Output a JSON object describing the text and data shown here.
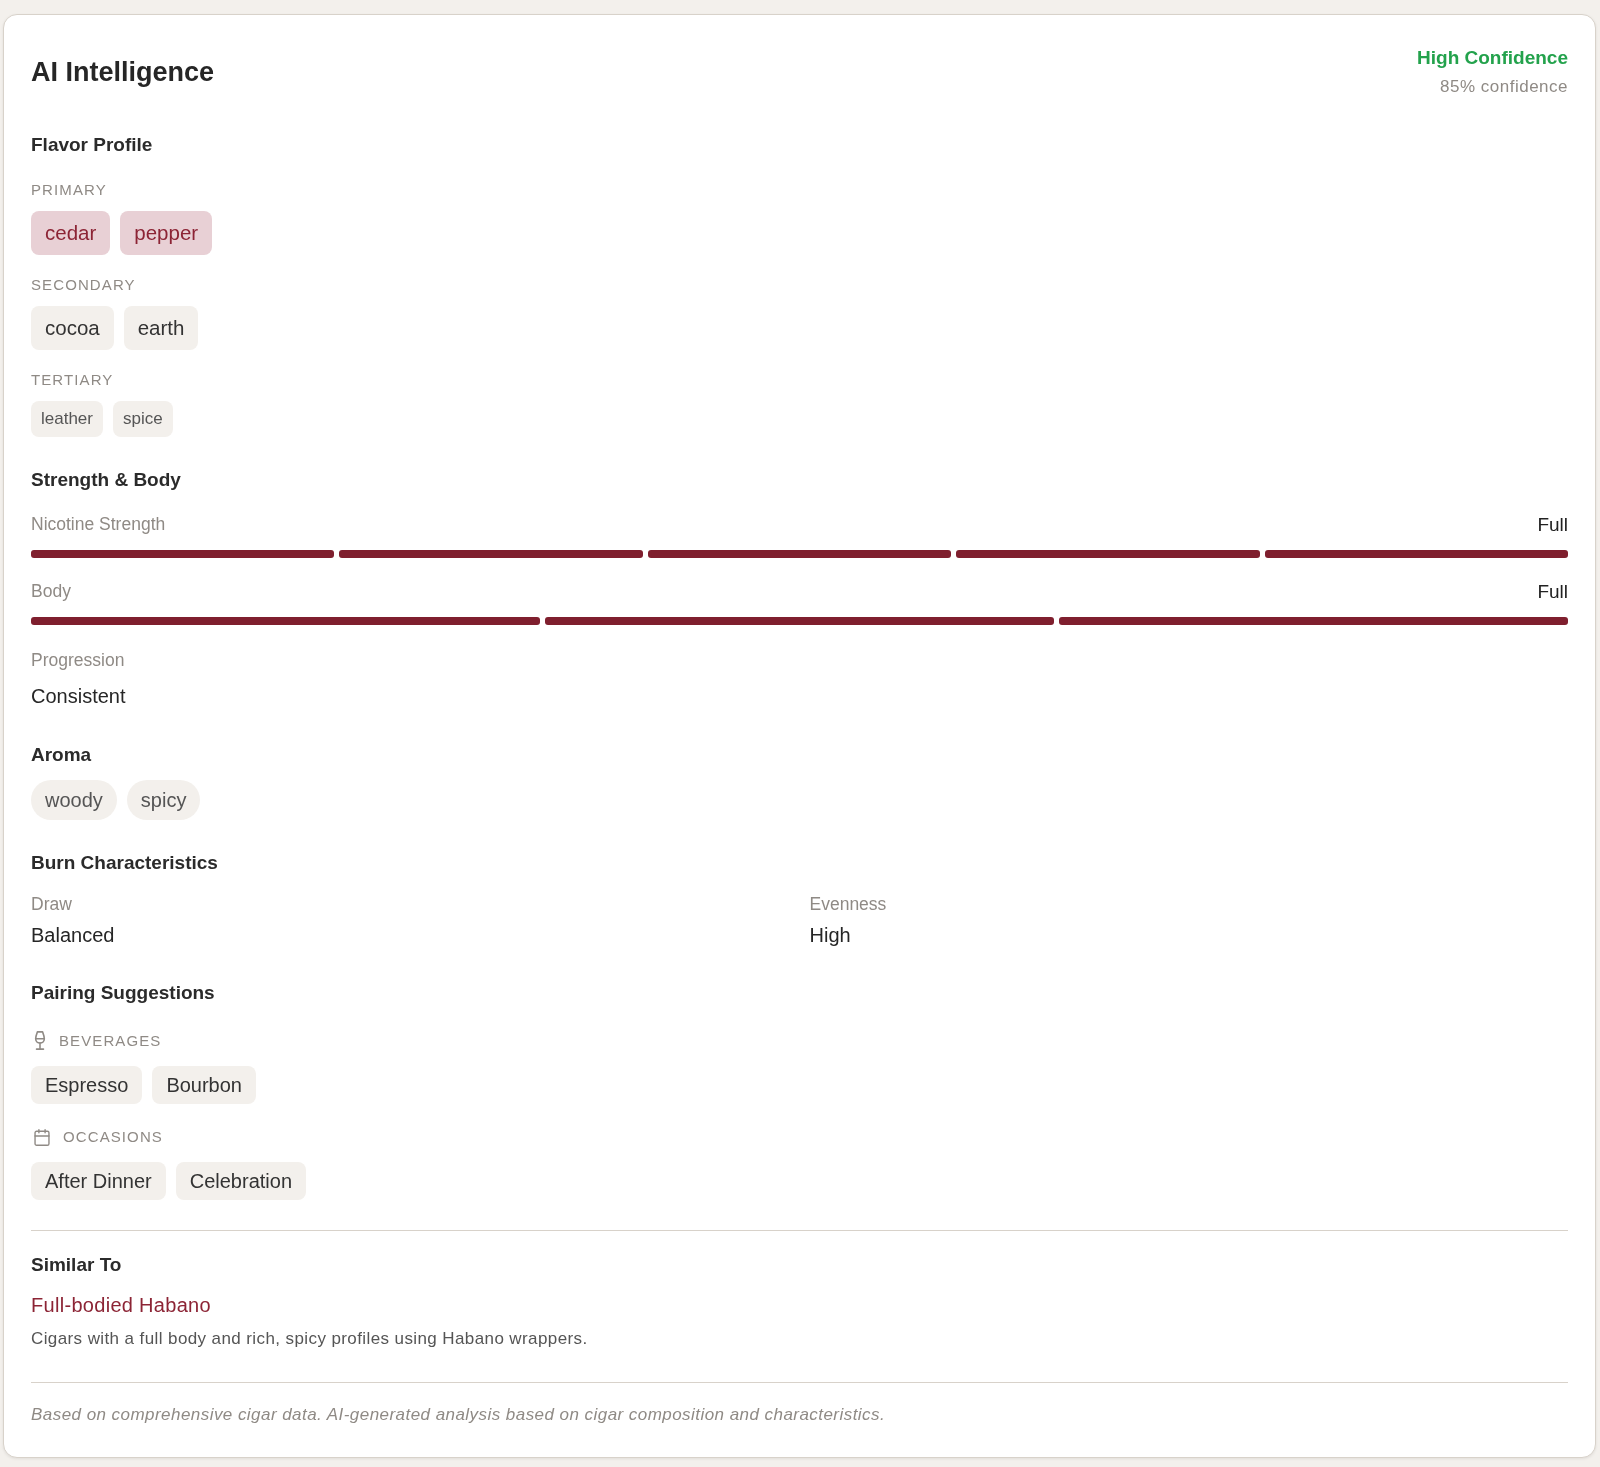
{
  "header": {
    "title": "AI Intelligence",
    "confidence": {
      "kind": "high",
      "label": "High Confidence",
      "detail": "85% confidence"
    }
  },
  "flavor_profile": {
    "title": "Flavor Profile",
    "tiers": [
      {
        "kind": "primary",
        "label": "PRIMARY",
        "notes": [
          "cedar",
          "pepper"
        ]
      },
      {
        "kind": "secondary",
        "label": "SECONDARY",
        "notes": [
          "cocoa",
          "earth"
        ]
      },
      {
        "kind": "tertiary",
        "label": "TERTIARY",
        "notes": [
          "leather",
          "spice"
        ]
      }
    ]
  },
  "strength_body": {
    "title": "Strength & Body",
    "meters": [
      {
        "label": "Nicotine Strength",
        "reading": "Full",
        "segments": [
          {
            "on": true
          },
          {
            "on": true
          },
          {
            "on": true
          },
          {
            "on": true
          },
          {
            "on": true
          }
        ]
      },
      {
        "label": "Body",
        "reading": "Full",
        "segments": [
          {
            "on": true
          },
          {
            "on": true
          },
          {
            "on": true
          }
        ]
      }
    ],
    "progression": {
      "label": "Progression",
      "value": "Consistent"
    }
  },
  "aroma": {
    "title": "Aroma",
    "notes": [
      "woody",
      "spicy"
    ]
  },
  "burn": {
    "title": "Burn Characteristics",
    "fields": [
      {
        "label": "Draw",
        "value": "Balanced"
      },
      {
        "label": "Evenness",
        "value": "High"
      }
    ]
  },
  "pairings": {
    "title": "Pairing Suggestions",
    "groups": [
      {
        "kind": "beverages",
        "label": "BEVERAGES",
        "items": [
          "Espresso",
          "Bourbon"
        ]
      },
      {
        "kind": "occasions",
        "label": "OCCASIONS",
        "items": [
          "After Dinner",
          "Celebration"
        ]
      }
    ]
  },
  "similar": {
    "title": "Similar To",
    "name": "Full-bodied Habano",
    "description": "Cigars with a full body and rich, spicy profiles using Habano wrappers."
  },
  "footnote": "Based on comprehensive cigar data. AI-generated analysis based on cigar composition and characteristics."
}
